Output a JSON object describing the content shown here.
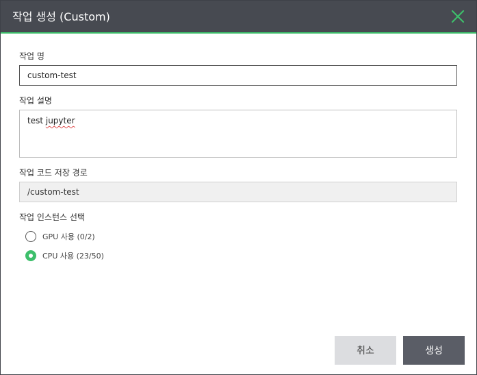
{
  "dialog": {
    "title": "작업 생성 (Custom)",
    "close_icon": "close-icon",
    "accent_color": "#3dbf6b",
    "header_color": "#474a51"
  },
  "form": {
    "name_label": "작업 명",
    "name_value": "custom-test",
    "desc_label": "작업 설명",
    "desc_value_plain": "test ",
    "desc_value_misspelled": "jupyter",
    "path_label": "작업 코드 저장 경로",
    "path_value": "/custom-test",
    "instance_label": "작업 인스턴스 선택",
    "instances": [
      {
        "label": "GPU 사용 (0/2)",
        "checked": false
      },
      {
        "label": "CPU 사용 (23/50)",
        "checked": true
      }
    ]
  },
  "actions": {
    "cancel_label": "취소",
    "create_label": "생성"
  }
}
